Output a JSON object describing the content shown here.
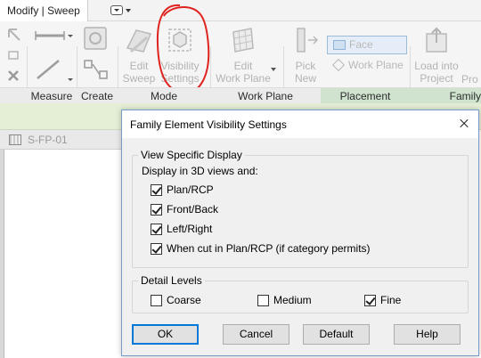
{
  "tabbar": {
    "active_tab": "Modify | Sweep",
    "qat_icon": "dropdown-box-icon"
  },
  "ribbon": {
    "buttons": {
      "edit_sweep": [
        "Edit",
        "Sweep"
      ],
      "visibility_settings": [
        "Visibility",
        "Settings"
      ],
      "edit_work_plane": [
        "Edit",
        "Work Plane"
      ],
      "pick_new": [
        "Pick",
        "New"
      ],
      "face": "Face",
      "work_plane": "Work Plane",
      "load_into_project": [
        "Load into",
        "Project"
      ],
      "pro_partial": "Pro"
    },
    "panels": {
      "measure": "Measure",
      "create": "Create",
      "mode": "Mode",
      "work_plane": "Work Plane",
      "placement": "Placement",
      "family_partial": "Family"
    },
    "annotation_color": "#e0231f"
  },
  "view": {
    "tab_label": "S-FP-01"
  },
  "dialog": {
    "title": "Family Element Visibility Settings",
    "view_specific": {
      "group_title": "View Specific Display",
      "sub_label": "Display in 3D views and:",
      "options": [
        {
          "label": "Plan/RCP",
          "checked": true
        },
        {
          "label": "Front/Back",
          "checked": true
        },
        {
          "label": "Left/Right",
          "checked": true
        },
        {
          "label": "When cut in Plan/RCP (if category permits)",
          "checked": true
        }
      ]
    },
    "detail_levels": {
      "group_title": "Detail Levels",
      "options": [
        {
          "label": "Coarse",
          "checked": false
        },
        {
          "label": "Medium",
          "checked": false
        },
        {
          "label": "Fine",
          "checked": true
        }
      ]
    },
    "buttons": {
      "ok": "OK",
      "cancel": "Cancel",
      "default": "Default",
      "help": "Help"
    }
  }
}
